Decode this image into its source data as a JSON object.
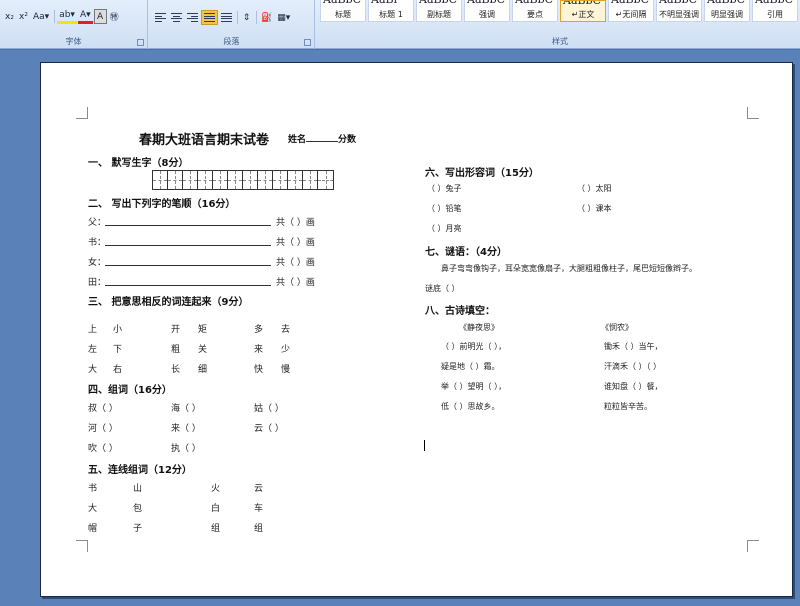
{
  "ribbon": {
    "font_group": {
      "label": "字体",
      "buttons": [
        "x₂",
        "x²",
        "Aa▾",
        "ab▾",
        "A▾",
        "A",
        "㊕"
      ]
    },
    "paragraph_group": {
      "label": "段落",
      "buttons": [
        "▾"
      ]
    },
    "styles_group": {
      "label": "样式",
      "styles": [
        {
          "preview": "AaBbC",
          "name": "标题"
        },
        {
          "preview": "AaBl",
          "name": "标题 1"
        },
        {
          "preview": "AaBbC",
          "name": "副标题"
        },
        {
          "preview": "AaBbC",
          "name": "强调"
        },
        {
          "preview": "AaBbC",
          "name": "要点"
        },
        {
          "preview": "AaBbC",
          "name": "↵正文"
        },
        {
          "preview": "AaBbC",
          "name": "↵无间隔"
        },
        {
          "preview": "AaBbC",
          "name": "不明显强调"
        },
        {
          "preview": "AaBbC",
          "name": "明显强调"
        },
        {
          "preview": "AaBbC",
          "name": "引用"
        }
      ],
      "selected": "↵正文"
    }
  },
  "colors": {
    "highlight": "#f4e600",
    "font_color": "#e02020",
    "accent": "#f6c44e"
  },
  "doc": {
    "title": "春期大班语言期末试卷",
    "name_label": "姓名",
    "score_label": "分数",
    "s1": "一、  默写生字（8分）",
    "s2": "二、  写出下列字的笔顺（16分）",
    "s2_rows": [
      {
        "char": "父：",
        "tail": "共（      ）画"
      },
      {
        "char": "书：",
        "tail": "共（      ）画"
      },
      {
        "char": "女：",
        "tail": "共（      ）画"
      },
      {
        "char": "田：",
        "tail": "共（      ）画"
      }
    ],
    "s3": "三、  把意思相反的词连起来（9分）",
    "s3_rows": [
      [
        "上",
        "小",
        "开",
        "矩",
        "多",
        "去"
      ],
      [
        "左",
        "下",
        "粗",
        "关",
        "来",
        "少"
      ],
      [
        "大",
        "右",
        "长",
        "细",
        "快",
        "慢"
      ]
    ],
    "s4": "四、组词（16分）",
    "s4_rows": [
      [
        "叔（      ）",
        "海（      ）",
        "姑（      ）"
      ],
      [
        "河（      ）",
        "来（      ）",
        "云（      ）"
      ],
      [
        "吹（      ）",
        "执（      ）"
      ]
    ],
    "s5": "五、连线组词（12分）",
    "s5_rows": [
      [
        "书",
        "山",
        "火",
        "云"
      ],
      [
        "大",
        "包",
        "白",
        "车"
      ],
      [
        "帽",
        "子",
        "组",
        "组"
      ]
    ],
    "s6": "六、写出形容词（15分）",
    "s6_rows": [
      [
        "（          ）兔子",
        "（          ）太阳"
      ],
      [
        "（          ）铅笔",
        "（          ）课本"
      ],
      [
        "（          ）月亮",
        ""
      ]
    ],
    "s7": "七、谜语：（4分）",
    "s7_riddle": "鼻子弯弯像钩子，耳朵宽宽像扇子，大腿粗粗像柱子，尾巴短短像辫子。",
    "s7_answer": "谜底（      ）",
    "s8": "八、古诗填空：",
    "poem1_title": "《静夜思》",
    "poem2_title": "《悯农》",
    "poem1": [
      "（      ）前明光（      ），",
      "疑是地（      ）霜。",
      "举（      ）望明（      ），",
      "低（      ）思故乡。"
    ],
    "poem2": [
      "锄禾（      ）当午，",
      "汗滴禾（      ）（      ）",
      "谁知盘（      ）餐，",
      "粒粒皆辛苦。"
    ]
  }
}
